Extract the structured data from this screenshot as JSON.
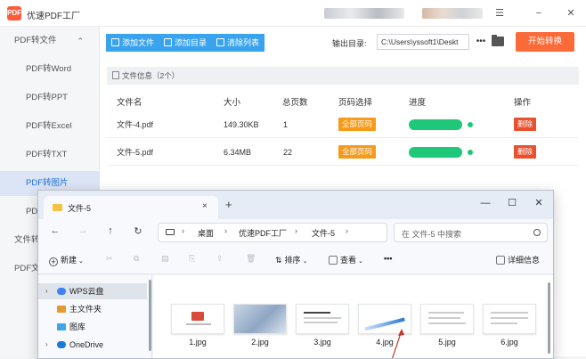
{
  "app": {
    "title": "优速PDF工厂",
    "logo_text": "PDF"
  },
  "window_controls": {
    "menu": "☰",
    "minimize": "−",
    "close": "✕"
  },
  "sidebar": {
    "group_label": "PDF转文件",
    "group_chevron": "⌃",
    "items": [
      {
        "label": "PDF转Word"
      },
      {
        "label": "PDF转PPT"
      },
      {
        "label": "PDF转Excel"
      },
      {
        "label": "PDF转TXT"
      },
      {
        "label": "PDF转图片"
      },
      {
        "label": "PD"
      }
    ],
    "other_groups": [
      {
        "label": "文件转"
      },
      {
        "label": "PDF文"
      }
    ]
  },
  "toolbar": {
    "add_file": "添加文件",
    "add_folder": "添加目录",
    "clear_list": "清除列表",
    "output_label": "输出目录:",
    "output_path": "C:\\Users\\yssoft1\\Deskt",
    "more": "•••",
    "start": "开始转换"
  },
  "file_info": {
    "label": "文件信息（2个）"
  },
  "table": {
    "headers": [
      "文件名",
      "大小",
      "总页数",
      "页码选择",
      "进度",
      "操作"
    ],
    "rows": [
      {
        "name": "文件-4.pdf",
        "size": "149.30KB",
        "pages": "1",
        "page_select": "全部页码",
        "progress": 1.0,
        "action": "删除"
      },
      {
        "name": "文件-5.pdf",
        "size": "6.34MB",
        "pages": "22",
        "page_select": "全部页码",
        "progress": 1.0,
        "action": "删除"
      }
    ]
  },
  "explorer": {
    "tab_title": "文件-5",
    "tab_close": "×",
    "new_tab": "+",
    "win_min": "—",
    "win_max": "☐",
    "win_close": "✕",
    "nav": {
      "back": "←",
      "forward": "→",
      "up": "↑",
      "refresh": "↻"
    },
    "breadcrumb": [
      "桌面",
      "优速PDF工厂",
      "文件-5"
    ],
    "breadcrumb_more": "›",
    "search_placeholder": "在 文件-5 中搜索",
    "commands": {
      "new": "新建",
      "sort": "排序",
      "view": "查看",
      "more": "•••",
      "details": "详细信息"
    },
    "nav_pane": [
      {
        "label": "WPS云盘",
        "chevron": "›",
        "selected": true
      },
      {
        "label": "主文件夹",
        "chevron": "",
        "selected": false
      },
      {
        "label": "图库",
        "chevron": "",
        "selected": false
      },
      {
        "label": "OneDrive",
        "chevron": "›",
        "selected": false
      }
    ],
    "files": [
      {
        "label": "1.jpg"
      },
      {
        "label": "2.jpg"
      },
      {
        "label": "3.jpg"
      },
      {
        "label": "4.jpg"
      },
      {
        "label": "5.jpg"
      },
      {
        "label": "6.jpg"
      }
    ]
  },
  "colors": {
    "accent_blue": "#3aa3ee",
    "start_orange": "#fb6b3a",
    "page_orange": "#f59a1a",
    "delete_red": "#e8512e",
    "progress_green": "#1fc878",
    "sidebar_active": "#dbe5f5"
  }
}
